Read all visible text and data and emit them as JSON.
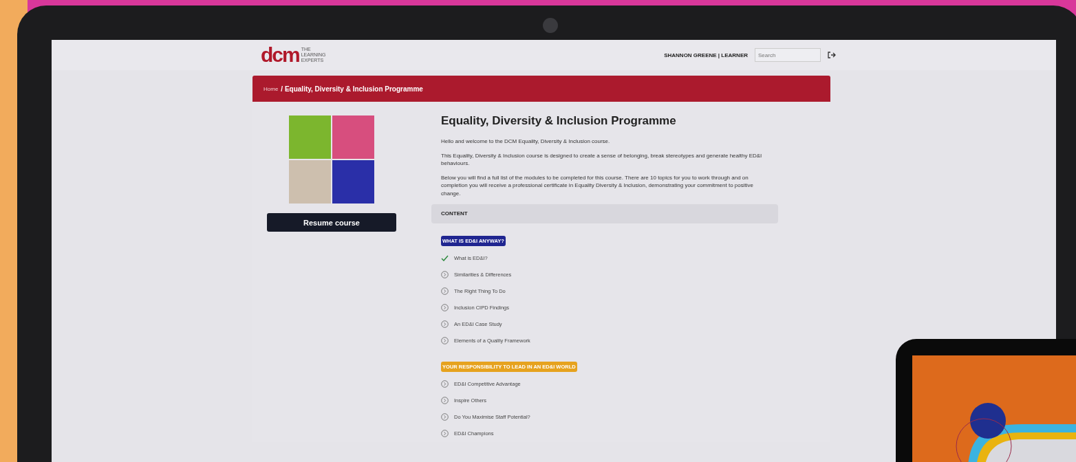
{
  "header": {
    "logo": "dcm",
    "logo_tagline": "THE LEARNING EXPERTS",
    "user": "SHANNON GREENE | LEARNER",
    "search": {
      "placeholder": "Search"
    }
  },
  "breadcrumb": {
    "home": "Home",
    "current": "/ Equality, Diversity & Inclusion Programme"
  },
  "course": {
    "resume_button": "Resume course",
    "title": "Equality, Diversity & Inclusion Programme",
    "paragraphs": [
      "Hello and welcome to the DCM Equality, Diversity & Inclusion course.",
      "This Equality, Diversity & Inclusion course is designed to create a sense of belonging, break stereotypes and generate healthy ED&I behaviours.",
      "Below you will find a full list of the modules to be completed for this course. There are 10 topics for you to work through and on completion you will receive a professional certificate in Equality Diversity & Inclusion, demonstrating your commitment to positive change."
    ]
  },
  "content": {
    "heading": "CONTENT",
    "sections": [
      {
        "title": "WHAT IS ED&I ANYWAY?",
        "color": "#1f2590",
        "modules": [
          {
            "label": "What is ED&I?",
            "completed": true
          },
          {
            "label": "Similarities & Differences",
            "completed": false
          },
          {
            "label": "The Right Thing To Do",
            "completed": false
          },
          {
            "label": "Inclusion CIPD Findings",
            "completed": false
          },
          {
            "label": "An ED&I Case Study",
            "completed": false
          },
          {
            "label": "Elements of a Quality Framework",
            "completed": false
          }
        ]
      },
      {
        "title": "YOUR RESPONSIBILITY TO LEAD IN AN ED&I WORLD",
        "color": "#e6a21e",
        "modules": [
          {
            "label": "ED&I Competitive Advantage",
            "completed": false
          },
          {
            "label": "Inspire Others",
            "completed": false
          },
          {
            "label": "Do You Maximise Staff Potential?",
            "completed": false
          },
          {
            "label": "ED&I Champions",
            "completed": false
          }
        ]
      }
    ]
  }
}
